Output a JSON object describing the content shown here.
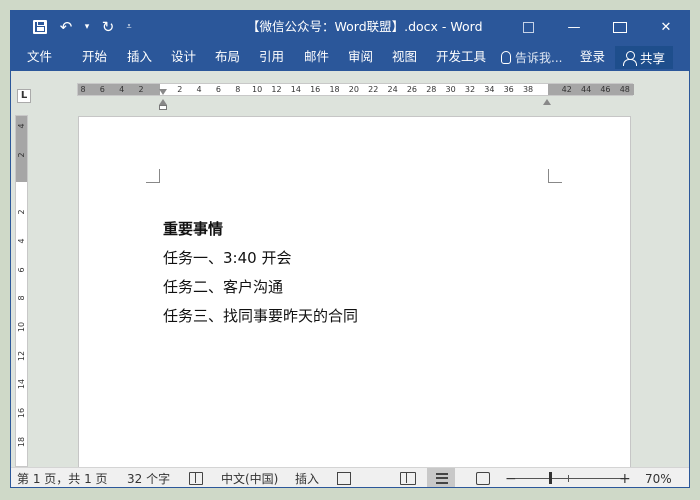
{
  "window": {
    "title": "【微信公众号：Word联盟】.docx - Word"
  },
  "qat": {
    "undo_glyph": "↶",
    "redo_glyph": "↻",
    "dropdown_glyph": "▾",
    "more_glyph": "⩡"
  },
  "winctrl": {
    "minimize": "—",
    "close": "✕"
  },
  "ribbon": {
    "tabs": [
      "文件",
      "开始",
      "插入",
      "设计",
      "布局",
      "引用",
      "邮件",
      "审阅",
      "视图",
      "开发工具"
    ],
    "tell_me": "告诉我...",
    "login": "登录",
    "share": "共享"
  },
  "ruler": {
    "corner": "L",
    "ticks": [
      "8",
      "6",
      "4",
      "2",
      "",
      "2",
      "4",
      "6",
      "8",
      "10",
      "12",
      "14",
      "16",
      "18",
      "20",
      "22",
      "24",
      "26",
      "28",
      "30",
      "32",
      "34",
      "36",
      "38",
      "",
      "42",
      "44",
      "46",
      "48"
    ],
    "vticks": [
      "4",
      "2",
      "",
      "2",
      "4",
      "6",
      "8",
      "10",
      "12",
      "14",
      "16",
      "18"
    ]
  },
  "document": {
    "heading": "重要事情",
    "lines": [
      "任务一、3:40 开会",
      "任务二、客户沟通",
      "任务三、找同事要昨天的合同"
    ]
  },
  "statusbar": {
    "page_info": "第 1 页，共 1 页",
    "word_count": "32 个字",
    "language": "中文(中国)",
    "insert_mode": "插入",
    "zoom_minus": "−",
    "zoom_plus": "+",
    "zoom": "70%"
  }
}
